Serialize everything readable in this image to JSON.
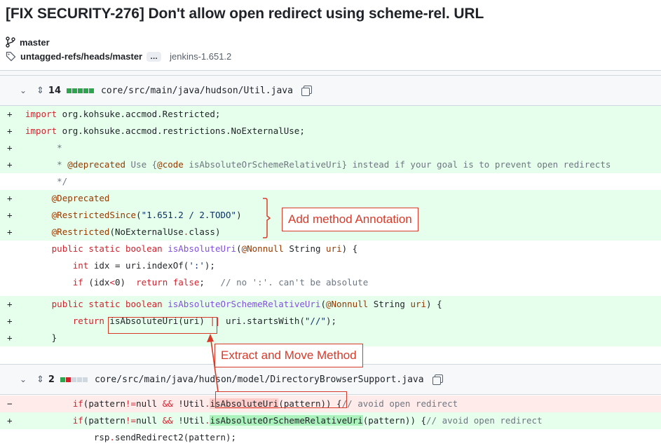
{
  "commit": {
    "title": "[FIX SECURITY-276] Don't allow open redirect using scheme-rel. URL",
    "branch": "master",
    "ref": "untagged-refs/heads/master",
    "ellipsis": "…",
    "tag": "jenkins-1.651.2"
  },
  "files": [
    {
      "path": "core/src/main/java/hudson/Util.java",
      "changes": "14",
      "bars": [
        "#2da44e",
        "#2da44e",
        "#2da44e",
        "#2da44e",
        "#2da44e"
      ],
      "icons": [
        "chevron-down-icon",
        "expand-icon",
        "copy-icon"
      ]
    },
    {
      "path": "core/src/main/java/hudson/model/DirectoryBrowserSupport.java",
      "changes": "2",
      "bars": [
        "#2da44e",
        "#cf222e",
        "#d0d7de",
        "#d0d7de",
        "#d0d7de"
      ],
      "icons": [
        "chevron-down-icon",
        "expand-icon",
        "copy-icon"
      ]
    }
  ],
  "annotations": {
    "add_method": "Add method Annotation",
    "extract_move": "Extract and Move Method"
  },
  "colors": {
    "add_bg": "#e6ffec",
    "del_bg": "#ffebe9",
    "callout": "#d83a2a"
  }
}
